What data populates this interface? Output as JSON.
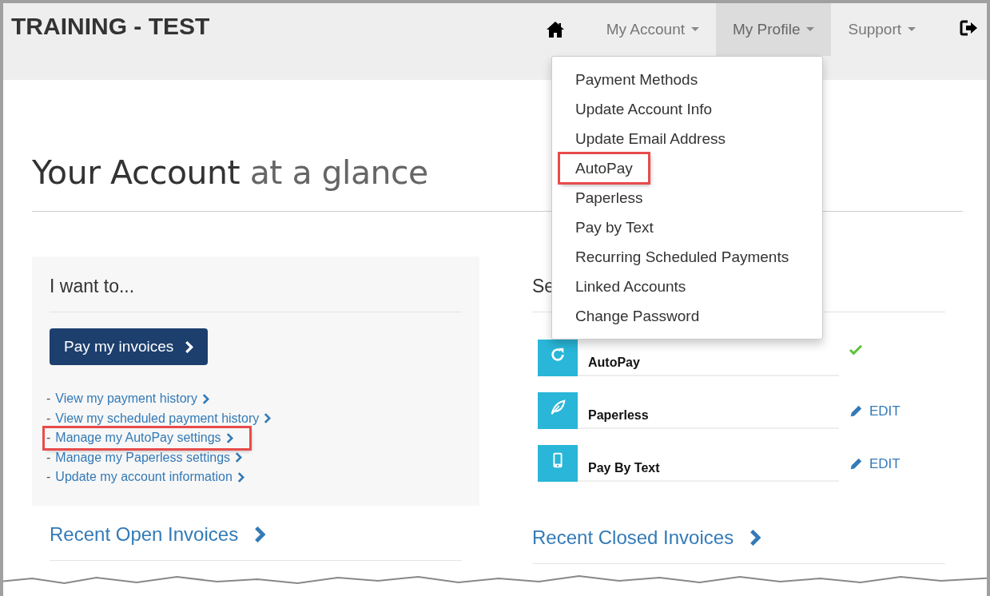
{
  "header": {
    "brand": "TRAINING - TEST",
    "nav": [
      {
        "kind": "home"
      },
      {
        "kind": "menu",
        "label": "My Account",
        "selected": false
      },
      {
        "kind": "menu",
        "label": "My Profile",
        "selected": true
      },
      {
        "kind": "menu",
        "label": "Support",
        "selected": false
      },
      {
        "kind": "logout"
      }
    ]
  },
  "dropdown": {
    "items": [
      {
        "label": "Payment Methods",
        "highlighted": false
      },
      {
        "label": "Update Account Info",
        "highlighted": false
      },
      {
        "label": "Update Email Address",
        "highlighted": false
      },
      {
        "label": "AutoPay",
        "highlighted": true
      },
      {
        "label": "Paperless",
        "highlighted": false
      },
      {
        "label": "Pay by Text",
        "highlighted": false
      },
      {
        "label": "Recurring Scheduled Payments",
        "highlighted": false
      },
      {
        "label": "Linked Accounts",
        "highlighted": false
      },
      {
        "label": "Change Password",
        "highlighted": false
      }
    ]
  },
  "page_title": {
    "main": "Your Account",
    "rest": "at a glance"
  },
  "i_want_to": {
    "heading": "I want to...",
    "button": "Pay my invoices",
    "links": [
      {
        "bullet": "-",
        "label": "View my payment history",
        "highlighted": false
      },
      {
        "bullet": "-",
        "label": "View my scheduled payment history",
        "highlighted": false
      },
      {
        "bullet": "-",
        "label": "Manage my AutoPay settings",
        "highlighted": true
      },
      {
        "bullet": "-",
        "label": "Manage my Paperless settings",
        "highlighted": false
      },
      {
        "bullet": "-",
        "label": "Update my account information",
        "highlighted": false
      }
    ]
  },
  "settings": {
    "heading": "Se",
    "rows": [
      {
        "kind": "refresh",
        "label": "AutoPay",
        "enabled": true
      },
      {
        "kind": "leaf",
        "label": "Paperless",
        "enabled": false,
        "action": "EDIT"
      },
      {
        "kind": "phone",
        "label": "Pay By Text",
        "enabled": false,
        "action": "EDIT"
      }
    ]
  },
  "recent_open": {
    "title": "Recent Open Invoices"
  },
  "recent_closed": {
    "title": "Recent Closed Invoices"
  }
}
